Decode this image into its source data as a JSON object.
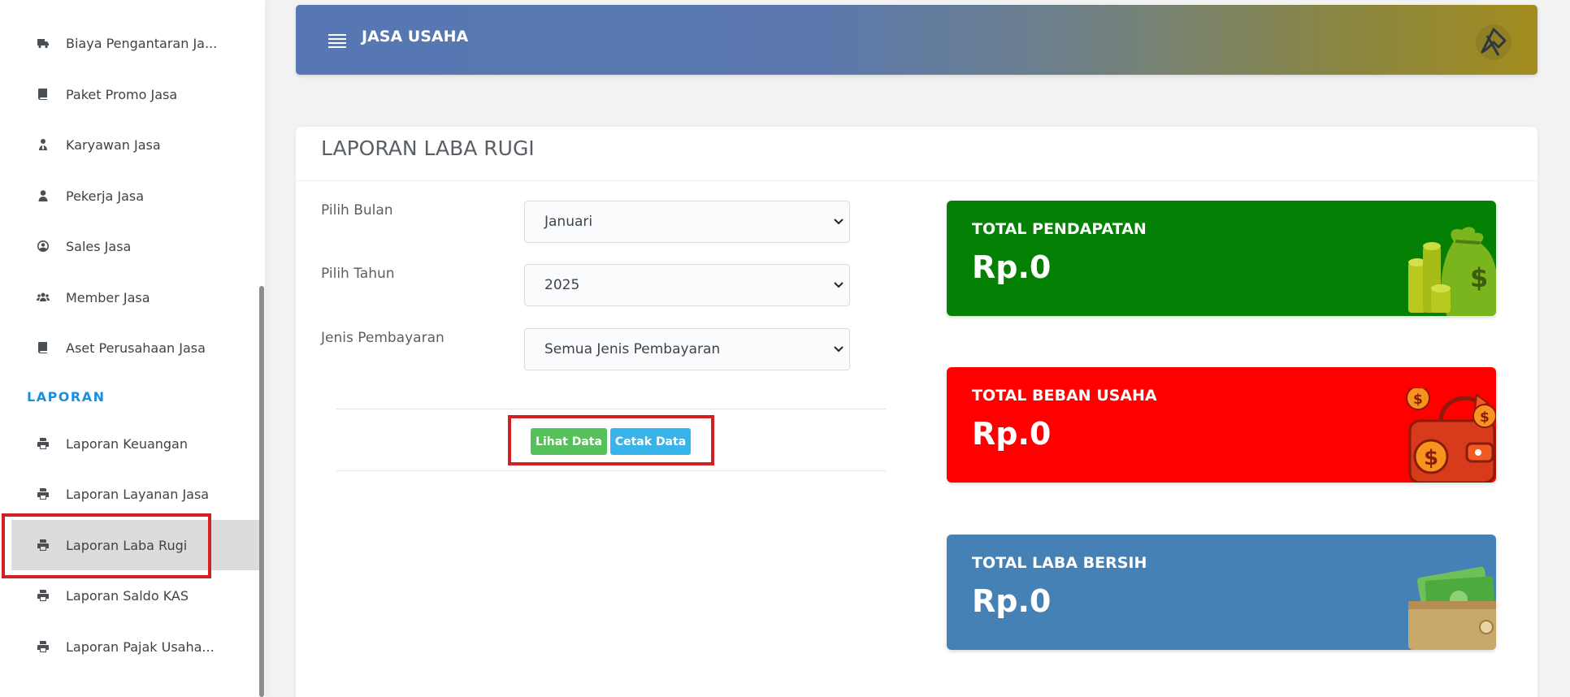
{
  "sidebar": {
    "items_top": [
      {
        "label": "Biaya Pengantaran Ja...",
        "icon": "truck-icon"
      },
      {
        "label": "Paket Promo Jasa",
        "icon": "book-icon"
      },
      {
        "label": "Karyawan Jasa",
        "icon": "user-tie-icon"
      },
      {
        "label": "Pekerja Jasa",
        "icon": "user-icon"
      },
      {
        "label": "Sales Jasa",
        "icon": "user-circle-icon"
      },
      {
        "label": "Member Jasa",
        "icon": "users-icon"
      },
      {
        "label": "Aset Perusahaan Jasa",
        "icon": "book-icon"
      }
    ],
    "section": "LAPORAN",
    "items_laporan": [
      {
        "label": "Laporan Keuangan",
        "icon": "print-icon"
      },
      {
        "label": "Laporan Layanan Jasa",
        "icon": "print-icon"
      },
      {
        "label": "Laporan Laba Rugi",
        "icon": "print-icon",
        "active": true
      },
      {
        "label": "Laporan Saldo KAS",
        "icon": "print-icon"
      },
      {
        "label": "Laporan Pajak Usaha...",
        "icon": "print-icon"
      }
    ]
  },
  "header": {
    "title": "JASA USAHA"
  },
  "report": {
    "title": "LAPORAN LABA RUGI",
    "fields": {
      "month": {
        "label": "Pilih Bulan",
        "value": "Januari"
      },
      "year": {
        "label": "Pilih Tahun",
        "value": "2025"
      },
      "payment": {
        "label": "Jenis Pembayaran",
        "value": "Semua Jenis Pembayaran"
      }
    },
    "buttons": {
      "view": "Lihat Data",
      "print": "Cetak Data"
    }
  },
  "stats": {
    "income": {
      "label": "TOTAL PENDAPATAN",
      "value": "Rp.0",
      "color": "#048004"
    },
    "expense": {
      "label": "TOTAL BEBAN USAHA",
      "value": "Rp.0",
      "color": "#fe0000"
    },
    "net": {
      "label": "TOTAL LABA BERSIH",
      "value": "Rp.0",
      "color": "#4681b6"
    }
  },
  "colors": {
    "section_accent": "#1a8fe0",
    "highlight": "#d42020",
    "btn_view": "#56c05a",
    "btn_print": "#39b4ea"
  }
}
